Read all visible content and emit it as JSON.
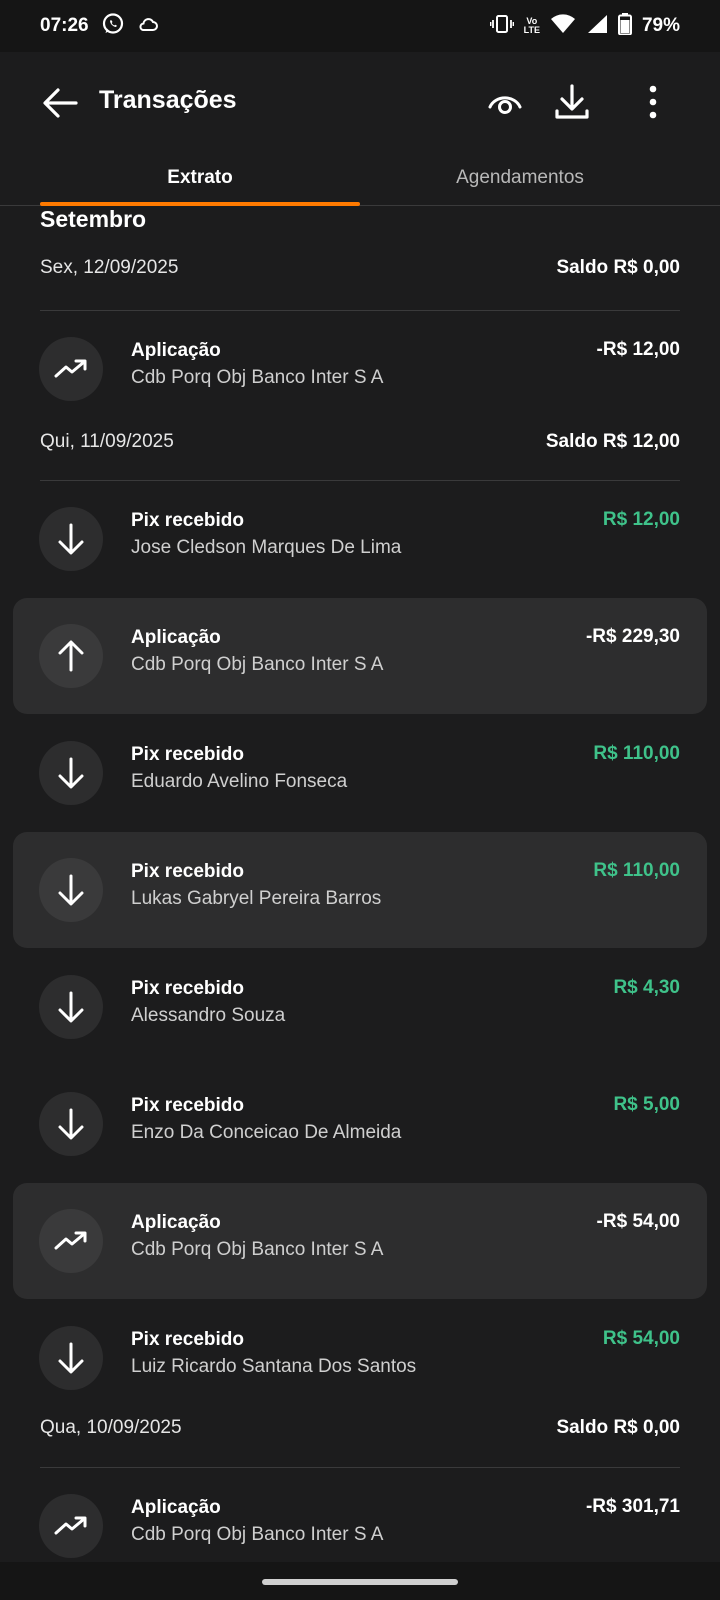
{
  "status_bar": {
    "time": "07:26",
    "battery": "79%",
    "network": "LTE",
    "volte": "Vo",
    "icons": [
      "whatsapp-icon",
      "cloud-icon",
      "vibrate-icon",
      "wifi-icon",
      "signal-icon",
      "battery-icon"
    ]
  },
  "header": {
    "title": "Transações",
    "icons": [
      "back-arrow-icon",
      "eye-icon",
      "download-icon",
      "more-vertical-icon"
    ]
  },
  "tabs": [
    {
      "label": "Extrato",
      "active": true
    },
    {
      "label": "Agendamentos",
      "active": false
    }
  ],
  "colors": {
    "accent": "#ff7a00",
    "positive": "#3fc28a",
    "background": "#1c1c1d",
    "card": "#2d2d2e"
  },
  "month": "Setembro",
  "days": [
    {
      "date": "Sex, 12/09/2025",
      "balance": "Saldo R$ 0,00"
    },
    {
      "date": "Qui, 11/09/2025",
      "balance": "Saldo R$ 12,00"
    },
    {
      "date": "Qua, 10/09/2025",
      "balance": "Saldo R$ 0,00"
    }
  ],
  "transactions": [
    {
      "title": "Aplicação",
      "subtitle": "Cdb Porq Obj Banco Inter S A",
      "amount": "-R$ 12,00",
      "icon": "trending-up-icon"
    },
    {
      "title": "Pix recebido",
      "subtitle": "Jose Cledson Marques De Lima",
      "amount": "R$ 12,00",
      "icon": "arrow-down-icon"
    },
    {
      "title": "Aplicação",
      "subtitle": "Cdb Porq Obj Banco Inter S A",
      "amount": "-R$ 229,30",
      "icon": "arrow-up-icon"
    },
    {
      "title": "Pix recebido",
      "subtitle": "Eduardo Avelino Fonseca",
      "amount": "R$ 110,00",
      "icon": "arrow-down-icon"
    },
    {
      "title": "Pix recebido",
      "subtitle": "Lukas Gabryel Pereira Barros",
      "amount": "R$ 110,00",
      "icon": "arrow-down-icon"
    },
    {
      "title": "Pix recebido",
      "subtitle": "Alessandro Souza",
      "amount": "R$ 4,30",
      "icon": "arrow-down-icon"
    },
    {
      "title": "Pix recebido",
      "subtitle": "Enzo Da Conceicao De Almeida",
      "amount": "R$ 5,00",
      "icon": "arrow-down-icon"
    },
    {
      "title": "Aplicação",
      "subtitle": "Cdb Porq Obj Banco Inter S A",
      "amount": "-R$ 54,00",
      "icon": "trending-up-icon"
    },
    {
      "title": "Pix recebido",
      "subtitle": "Luiz Ricardo Santana Dos Santos",
      "amount": "R$ 54,00",
      "icon": "arrow-down-icon"
    },
    {
      "title": "Aplicação",
      "subtitle": "Cdb Porq Obj Banco Inter S A",
      "amount": "-R$ 301,71",
      "icon": "trending-up-icon"
    }
  ]
}
